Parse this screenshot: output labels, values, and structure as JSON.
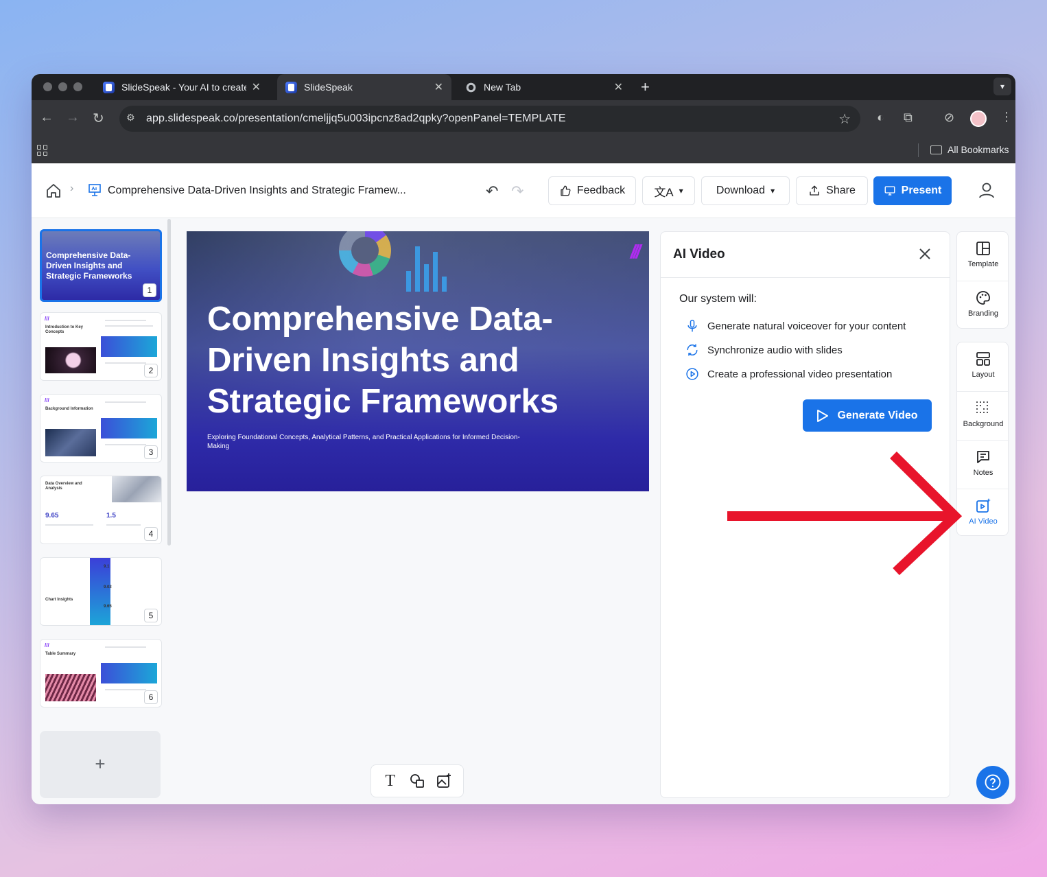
{
  "browser": {
    "tabs": [
      {
        "title": "SlideSpeak - Your AI to create",
        "active": false
      },
      {
        "title": "SlideSpeak",
        "active": true
      },
      {
        "title": "New Tab",
        "active": false
      }
    ],
    "url": "app.slidespeak.co/presentation/cmeljjq5u003ipcnz8ad2qpky?openPanel=TEMPLATE",
    "bookmarks_label": "All Bookmarks"
  },
  "header": {
    "doc_title": "Comprehensive Data-Driven Insights and Strategic Framew...",
    "feedback": "Feedback",
    "download": "Download",
    "share": "Share",
    "present": "Present"
  },
  "thumbnails": [
    {
      "number": "1",
      "title": "Comprehensive Data-Driven Insights and Strategic Frameworks"
    },
    {
      "number": "2",
      "title": "Introduction to Key Concepts"
    },
    {
      "number": "3",
      "title": "Background Information"
    },
    {
      "number": "4",
      "title": "Data Overview and Analysis",
      "value_a": "9.65",
      "value_b": "1.5"
    },
    {
      "number": "5",
      "title": "Chart Insights",
      "v1": "9.1",
      "v2": "9.02",
      "v3": "9.65"
    },
    {
      "number": "6",
      "title": "Table Summary"
    }
  ],
  "slide": {
    "title": "Comprehensive Data-Driven Insights and Strategic Frameworks",
    "subtitle": "Exploring Foundational Concepts, Analytical Patterns, and Practical Applications for Informed Decision-Making"
  },
  "panel": {
    "title": "AI Video",
    "intro": "Our system will:",
    "features": [
      "Generate natural voiceover for your content",
      "Synchronize audio with slides",
      "Create a professional video presentation"
    ],
    "generate_button": "Generate Video"
  },
  "rail": {
    "template": "Template",
    "branding": "Branding",
    "layout": "Layout",
    "background": "Background",
    "notes": "Notes",
    "ai_video": "AI Video"
  },
  "colors": {
    "accent": "#1a73e8",
    "annotation": "#e8142b",
    "brand_logo": "#b02cf0"
  }
}
